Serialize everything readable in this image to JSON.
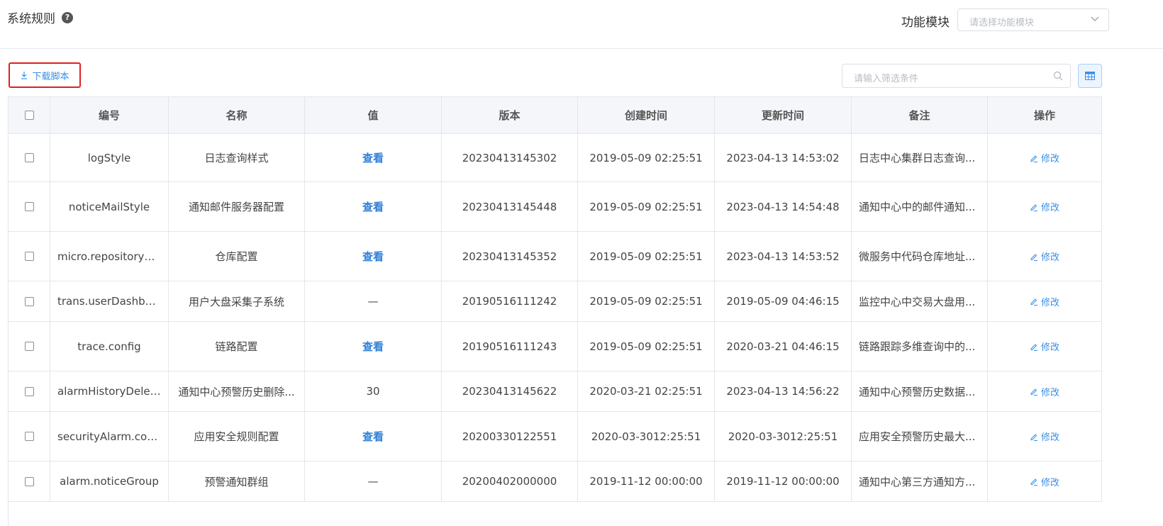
{
  "header": {
    "title": "系统规则",
    "help_glyph": "?",
    "module_label": "功能模块",
    "module_placeholder": "请选择功能模块"
  },
  "toolbar": {
    "download_label": "下载脚本",
    "filter_placeholder": "请输入筛选条件"
  },
  "icons": {
    "help": "question-circle-icon",
    "chevron": "chevron-down-icon",
    "download": "download-icon",
    "search": "search-icon",
    "grid": "table-grid-icon",
    "edit": "edit-pen-icon"
  },
  "colors": {
    "accent": "#3a8ee6",
    "highlight_border": "#e02020",
    "header_bg": "#f4f6fa"
  },
  "table": {
    "columns": [
      "编号",
      "名称",
      "值",
      "版本",
      "创建时间",
      "更新时间",
      "备注",
      "操作"
    ],
    "rows": [
      {
        "id": "logStyle",
        "name": "日志查询样式",
        "value": "查看",
        "value_is_link": true,
        "version": "20230413145302",
        "created": "2019-05-09 02:25:51",
        "updated": "2023-04-13 14:53:02",
        "remark": "日志中心集群日志查询...",
        "action": "修改"
      },
      {
        "id": "noticeMailStyle",
        "name": "通知邮件服务器配置",
        "value": "查看",
        "value_is_link": true,
        "version": "20230413145448",
        "created": "2019-05-09 02:25:51",
        "updated": "2023-04-13 14:54:48",
        "remark": "通知中心中的邮件通知...",
        "action": "修改"
      },
      {
        "id": "micro.repositoryCo...",
        "name": "仓库配置",
        "value": "查看",
        "value_is_link": true,
        "version": "20230413145352",
        "created": "2019-05-09 02:25:51",
        "updated": "2023-04-13 14:53:52",
        "remark": "微服务中代码仓库地址...",
        "action": "修改"
      },
      {
        "id": "trans.userDashboa...",
        "name": "用户大盘采集子系统",
        "value": "—",
        "value_is_link": false,
        "version": "20190516111242",
        "created": "2019-05-09 02:25:51",
        "updated": "2019-05-09 04:46:15",
        "remark": "监控中心中交易大盘用...",
        "action": "修改"
      },
      {
        "id": "trace.config",
        "name": "链路配置",
        "value": "查看",
        "value_is_link": true,
        "version": "20190516111243",
        "created": "2019-05-09 02:25:51",
        "updated": "2020-03-21 04:46:15",
        "remark": "链路跟踪多维查询中的...",
        "action": "修改"
      },
      {
        "id": "alarmHistoryDelet...",
        "name": "通知中心预警历史删除...",
        "value": "30",
        "value_is_link": false,
        "version": "20230413145622",
        "created": "2020-03-21 02:25:51",
        "updated": "2023-04-13 14:56:22",
        "remark": "通知中心预警历史数据...",
        "action": "修改"
      },
      {
        "id": "securityAlarm.config",
        "name": "应用安全规则配置",
        "value": "查看",
        "value_is_link": true,
        "version": "20200330122551",
        "created": "2020-03-3012:25:51",
        "updated": "2020-03-3012:25:51",
        "remark": "应用安全预警历史最大...",
        "action": "修改"
      },
      {
        "id": "alarm.noticeGroup",
        "name": "预警通知群组",
        "value": "—",
        "value_is_link": false,
        "version": "20200402000000",
        "created": "2019-11-12 00:00:00",
        "updated": "2019-11-12 00:00:00",
        "remark": "通知中心第三方通知方...",
        "action": "修改"
      }
    ]
  }
}
